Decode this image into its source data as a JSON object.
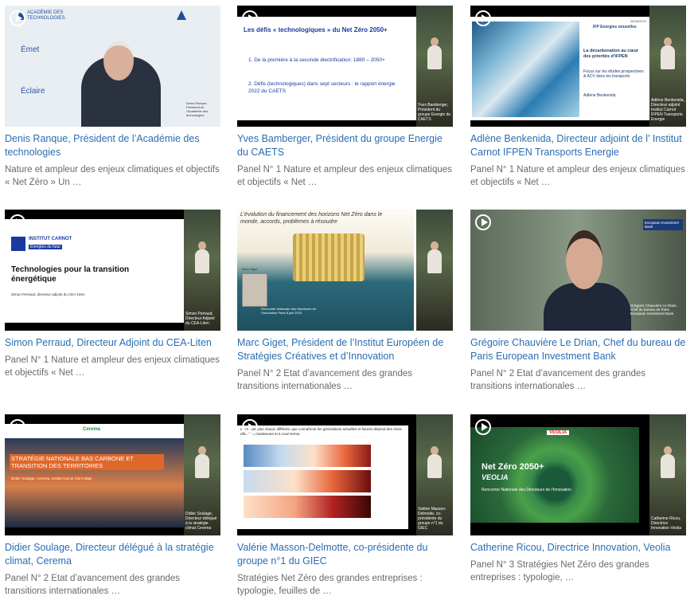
{
  "cards": [
    {
      "title": "Denis Ranque, Président de l’Académie des technologies",
      "desc": "Nature et ampleur des enjeux climatiques et objectifs « Net Zéro » Un …",
      "thumb": {
        "brand": "ACADÉMIE DES TECHNOLOGIES",
        "words": [
          "Émet",
          "Éclaire"
        ],
        "caption": "Denis Ranque, Président de l’Académie des technologies"
      }
    },
    {
      "title": "Yves Bamberger, Président du groupe Energie du CAETS",
      "desc": "Panel N° 1 Nature et ampleur des enjeux climatiques et objectifs « Net …",
      "thumb": {
        "heading": "Les défis « technologiques » du Net Zéro 2050+",
        "items": [
          "De la première à la seconde électrification: 1880 – 2050+",
          "Défis (technologiques) dans sept secteurs : le rapport énergie 2022 du CAETS"
        ],
        "caption": "Yves Bamberger, Président du groupe Energie du CAETS"
      }
    },
    {
      "title": "Adlène Benkenida, Directeur adjoint de l’ Institut Carnot IFPEN Transports Energie",
      "desc": "Panel N° 1 Nature et ampleur des enjeux climatiques et objectifs « Net …",
      "thumb": {
        "logo": "IFP Energies nouvelles",
        "heading": "La décarbonation au cœur des priorités d’IFPEN",
        "sub": "Focus sur les études prospectives & ACV dans les transports",
        "name": "Adlène Benkenida",
        "date": "08/06/2023",
        "caption": "Adlène Benkenida, Directeur adjoint Institut Carnot IFPEN Transports Energie"
      }
    },
    {
      "title": "Simon Perraud, Directeur Adjoint du CEA-Liten",
      "desc": "Panel N° 1 Nature et ampleur des enjeux climatiques et objectifs « Net …",
      "thumb": {
        "logo1": "INSTITUT CARNOT",
        "logo2": "Energies du futur",
        "heading": "Technologies pour la transition énergétique",
        "sub": "Simon Perraud, directeur adjoint du CEA-Liten",
        "caption": "Simon Perraud, Directeur Adjoint du CEA-Liten"
      }
    },
    {
      "title": "Marc Giget, Président de l’Institut Européen de Stratégies Créatives et d’Innovation",
      "desc": "Panel N° 2 Etat d’avancement des grandes transitions internationales …",
      "thumb": {
        "heading": "L’évolution du financement des horizons Net Zéro dans le monde, accords, problèmes à résoudre",
        "name": "Marc Giget",
        "event": "Rencontre Nationale des Directeurs de l’Innovation Paris 8 juin 2023"
      }
    },
    {
      "title": "Grégoire Chauvière Le Drian, Chef du bureau de Paris European Investment Bank",
      "desc": "Panel N° 2 Etat d’avancement des grandes transitions internationales …",
      "thumb": {
        "logo": "European Investment Bank",
        "caption": "Grégoire Chauvière Le Drian, Chef du bureau de Paris European Investment Bank"
      }
    },
    {
      "title": "Didier Soulage, Directeur délégué à la stratégie climat, Cerema",
      "desc": "Panel N° 2 Etat d’avancement des grandes transitions internationales …",
      "thumb": {
        "logo": "Cerema",
        "heading": "STRATÉGIE NATIONALE BAS CARBONE ET TRANSITION DES TERRITOIRES",
        "sub": "Didier Soulage, Cerema, Institut Carnot Clim'Adapt",
        "caption": "Didier Soulage, Directeur délégué à la stratégie climat Cerema"
      }
    },
    {
      "title": "Valérie Masson-Delmotte, co-présidente du groupe n°1 du GIEC",
      "desc": "Stratégies Net Zéro des grandes entreprises : typologie, feuilles de …",
      "thumb": {
        "heading": "Le monde plus chaud, différent, que connaîtront les générations actuelles et futures dépend des choix effectués maintenant et à court terme",
        "caption": "Valérie Masson-Delmotte, co-présidente du groupe n°1 du GIEC"
      }
    },
    {
      "title": "Catherine Ricou, Directrice Innovation, Veolia",
      "desc": "Panel N° 3 Stratégies Net Zéro des grandes entreprises : typologie, …",
      "thumb": {
        "logo": "VEOLIA",
        "heading": "Net Zéro 2050+",
        "brand": "VEOLIA",
        "sub": "Rencontre Nationale des Directeurs de l’Innovation",
        "caption": "Catherine Ricou, Directrice Innovation Veolia"
      }
    }
  ],
  "colors": {
    "link": "#2a6db3",
    "desc": "#6a6a6a",
    "slide_blue": "#1a3aa0",
    "veolia_red": "#e2231a"
  }
}
